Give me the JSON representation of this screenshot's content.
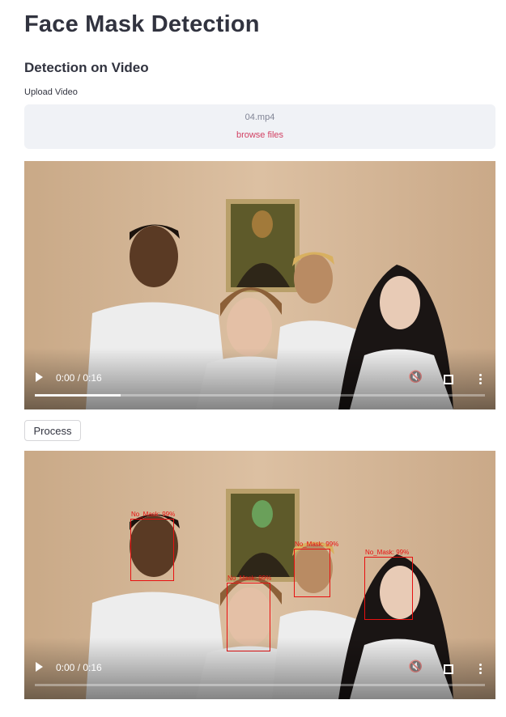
{
  "page": {
    "title": "Face Mask Detection"
  },
  "section": {
    "title": "Detection on Video"
  },
  "upload": {
    "label": "Upload Video",
    "file_name": "04.mp4",
    "browse_label": "browse files"
  },
  "input_video": {
    "time": "0:00 / 0:16",
    "progress_fraction": 0.19
  },
  "process_button": {
    "label": "Process"
  },
  "output_video": {
    "time": "0:00 / 0:16",
    "progress_fraction": 0.0,
    "detections": [
      {
        "label": "No_Mask: 99%"
      },
      {
        "label": "No_Mask: 99%"
      },
      {
        "label": "No_Mask: 99%"
      },
      {
        "label": "No_Mask: 99%"
      }
    ]
  },
  "colors": {
    "background_video": "#d2b496",
    "detection_box": "#e81010",
    "accent_link": "#d24163",
    "dropzone_bg": "#f0f2f6"
  },
  "icons": [
    "play-icon",
    "volume-icon",
    "fullscreen-icon",
    "more-options-icon"
  ]
}
